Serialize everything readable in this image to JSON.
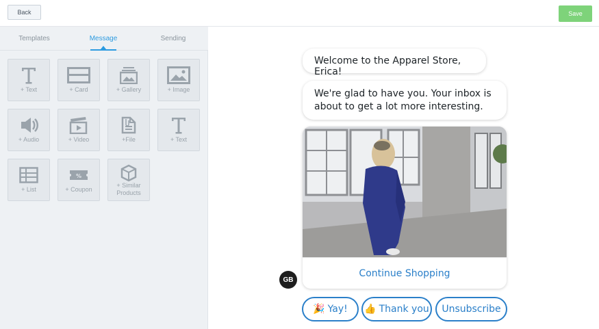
{
  "toolbar": {
    "back_label": "Back",
    "save_label": "Save",
    "save_color": "#7ed37a"
  },
  "tabs": [
    {
      "label": "Templates",
      "active": false
    },
    {
      "label": "Message",
      "active": true
    },
    {
      "label": "Sending",
      "active": false
    }
  ],
  "blocks": [
    {
      "label": "+ Text",
      "icon": "text-icon"
    },
    {
      "label": "+ Card",
      "icon": "card-icon"
    },
    {
      "label": "+ Gallery",
      "icon": "gallery-icon"
    },
    {
      "label": "+ Image",
      "icon": "image-icon"
    },
    {
      "label": "+ Audio",
      "icon": "audio-icon"
    },
    {
      "label": "+ Video",
      "icon": "video-icon"
    },
    {
      "label": "+File",
      "icon": "file-icon"
    },
    {
      "label": "+ Text",
      "icon": "text-icon"
    },
    {
      "label": "+ List",
      "icon": "list-icon"
    },
    {
      "label": "+ Coupon",
      "icon": "coupon-icon"
    },
    {
      "label": "+ Similar Products",
      "label_line1": "+ Similar",
      "label_line2": "Products",
      "icon": "cube-icon"
    }
  ],
  "preview": {
    "message1": "Welcome to the Apparel Store, Erica!",
    "message2": "We're glad to have you. Your inbox is about to get a lot more interesting.",
    "card_button": "Continue Shopping",
    "avatar_initials": "GB",
    "quick_replies": [
      {
        "emoji": "🎉",
        "label": "Yay!"
      },
      {
        "emoji": "👍",
        "label": "Thank you"
      },
      {
        "emoji": "",
        "label": "Unsubscribe"
      }
    ],
    "accent_color": "#2a7fc9"
  }
}
